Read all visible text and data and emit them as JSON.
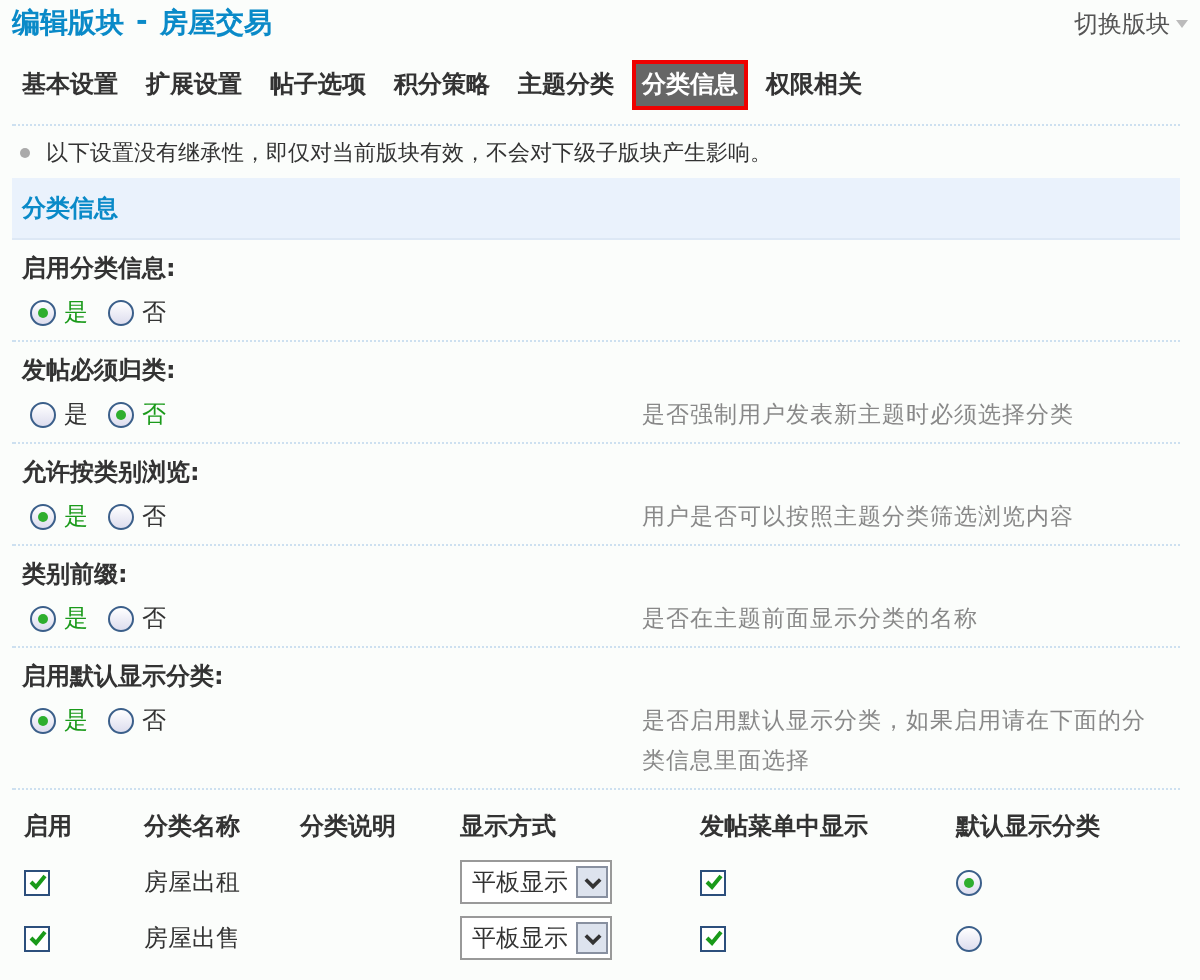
{
  "header": {
    "title": "编辑版块",
    "separator": "-",
    "forum": "房屋交易",
    "switch_label": "切换版块"
  },
  "tabs": [
    {
      "label": "基本设置",
      "selected": false
    },
    {
      "label": "扩展设置",
      "selected": false
    },
    {
      "label": "帖子选项",
      "selected": false
    },
    {
      "label": "积分策略",
      "selected": false
    },
    {
      "label": "主题分类",
      "selected": false
    },
    {
      "label": "分类信息",
      "selected": true
    },
    {
      "label": "权限相关",
      "selected": false
    }
  ],
  "notice": "以下设置没有继承性，即仅对当前版块有效，不会对下级子版块产生影响。",
  "section": {
    "title": "分类信息"
  },
  "settings": [
    {
      "label": "启用分类信息:",
      "options": [
        {
          "label": "是",
          "selected": true
        },
        {
          "label": "否",
          "selected": false
        }
      ]
    },
    {
      "label": "发帖必须归类:",
      "options": [
        {
          "label": "是",
          "selected": false
        },
        {
          "label": "否",
          "selected": true
        }
      ],
      "description": "是否强制用户发表新主题时必须选择分类"
    },
    {
      "label": "允许按类别浏览:",
      "options": [
        {
          "label": "是",
          "selected": true
        },
        {
          "label": "否",
          "selected": false
        }
      ],
      "description": "用户是否可以按照主题分类筛选浏览内容"
    },
    {
      "label": "类别前缀:",
      "options": [
        {
          "label": "是",
          "selected": true
        },
        {
          "label": "否",
          "selected": false
        }
      ],
      "description": "是否在主题前面显示分类的名称"
    },
    {
      "label": "启用默认显示分类:",
      "options": [
        {
          "label": "是",
          "selected": true
        },
        {
          "label": "否",
          "selected": false
        }
      ],
      "description": "是否启用默认显示分类，如果启用请在下面的分类信息里面选择"
    }
  ],
  "table": {
    "columns": [
      "启用",
      "分类名称",
      "分类说明",
      "显示方式",
      "发帖菜单中显示",
      "默认显示分类"
    ],
    "rows": [
      {
        "enabled": true,
        "name": "房屋出租",
        "display": "平板显示",
        "in_menu": true,
        "default": true
      },
      {
        "enabled": true,
        "name": "房屋出售",
        "display": "平板显示",
        "in_menu": true,
        "default": false
      }
    ]
  }
}
